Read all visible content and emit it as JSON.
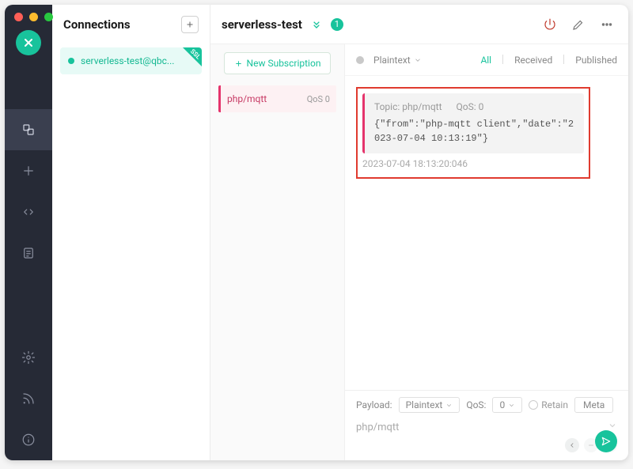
{
  "sidebar": {
    "title": "Connections",
    "items": [
      {
        "name": "serverless-test@qbc...",
        "ssl_badge": "SSL"
      }
    ]
  },
  "header": {
    "title": "serverless-test",
    "badge_count": "1"
  },
  "subscriptions": {
    "new_button": "New Subscription",
    "items": [
      {
        "topic": "php/mqtt",
        "qos": "QoS 0"
      }
    ]
  },
  "messages": {
    "format": "Plaintext",
    "filters": {
      "all": "All",
      "received": "Received",
      "published": "Published"
    },
    "items": [
      {
        "topic_label": "Topic:",
        "topic": "php/mqtt",
        "qos_label": "QoS:",
        "qos": "0",
        "body": "{\"from\":\"php-mqtt client\",\"date\":\"2023-07-04 10:13:19\"}",
        "timestamp": "2023-07-04 18:13:20:046"
      }
    ]
  },
  "composer": {
    "payload_label": "Payload:",
    "payload_format": "Plaintext",
    "qos_label": "QoS:",
    "qos_value": "0",
    "retain_label": "Retain",
    "meta_label": "Meta",
    "topic": "php/mqtt"
  }
}
